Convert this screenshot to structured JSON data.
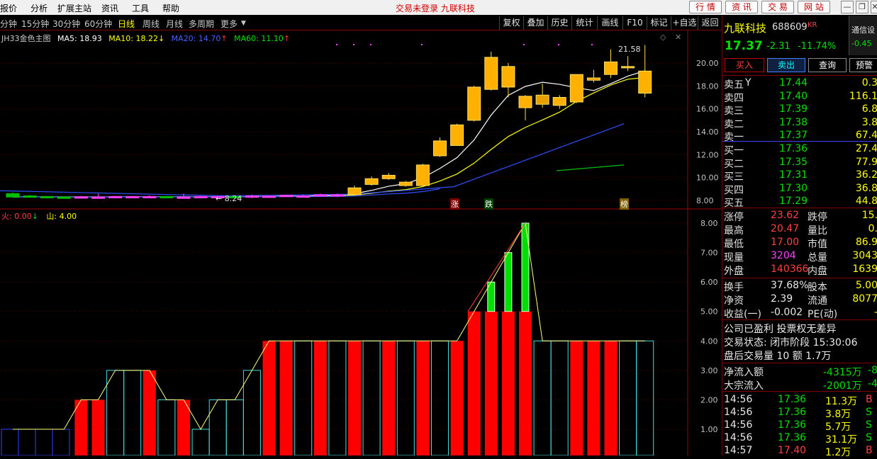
{
  "menubar": {
    "items": [
      "报价",
      "分析",
      "扩展主站",
      "资讯",
      "工具",
      "帮助"
    ],
    "status": "交易未登录 九联科技",
    "buttons": [
      "行 情",
      "资 讯",
      "交 易",
      "网 站"
    ]
  },
  "periods": {
    "items": [
      "分钟",
      "15分钟",
      "30分钟",
      "60分钟",
      "日线",
      "周线",
      "月线",
      "多周期",
      "更多"
    ],
    "active": "日线",
    "tools": [
      "复权",
      "叠加",
      "历史",
      "统计",
      "画线",
      "F10",
      "标记",
      "+自选",
      "返回"
    ]
  },
  "main_chart": {
    "indicator_name": "JH33金色主图",
    "ma": [
      {
        "label": "MA5: 18.93",
        "color": "#ffffff"
      },
      {
        "label": "MA10: 18.22",
        "color": "#ffff00",
        "arrow": "↓"
      },
      {
        "label": "MA20: 14.70",
        "color": "#4040ff",
        "arrow": "↑"
      },
      {
        "label": "MA60: 11.10",
        "color": "#00e000",
        "arrow": "↑"
      }
    ],
    "high_label": "21.58",
    "low_label": "8.24",
    "y_ticks": [
      "20.00",
      "18.00",
      "16.00",
      "14.00",
      "12.00",
      "10.00",
      "8.00"
    ],
    "markers": [
      "涨",
      "跌",
      "榜"
    ]
  },
  "sub_chart": {
    "label1": "火: 0.00",
    "label1_arrow": "↓",
    "label2": "山: 4.00",
    "y_ticks": [
      "8.00",
      "7.00",
      "6.00",
      "5.00",
      "4.00",
      "3.00",
      "2.00",
      "1.00"
    ]
  },
  "chart_data": {
    "type": "bar",
    "sub_series_levels": [
      1,
      1,
      1,
      1,
      2,
      2,
      3,
      3,
      3,
      2,
      2,
      1,
      2,
      2,
      3,
      4,
      4,
      4,
      4,
      4,
      4,
      4,
      4,
      4,
      4,
      4,
      4,
      5,
      6,
      7,
      8,
      4,
      4,
      4,
      4,
      4,
      4,
      4
    ],
    "ylim": [
      0.5,
      8.5
    ]
  },
  "stock": {
    "name": "九联科技",
    "code": "688609",
    "badge": "KR",
    "price": "17.37",
    "change": "-2.31",
    "pct": "-11.74%",
    "sector": "通信设",
    "sector_pct": "-0.45",
    "buttons": [
      "买入",
      "卖出",
      "查询",
      "预警"
    ],
    "asks": [
      {
        "label": "卖五",
        "mark": "Y",
        "price": "17.44",
        "vol": "0.3"
      },
      {
        "label": "卖四",
        "mark": "",
        "price": "17.40",
        "vol": "116.1"
      },
      {
        "label": "卖三",
        "mark": "",
        "price": "17.39",
        "vol": "6.8"
      },
      {
        "label": "卖二",
        "mark": "",
        "price": "17.38",
        "vol": "3.8"
      },
      {
        "label": "卖一",
        "mark": "",
        "price": "17.37",
        "vol": "67.4"
      }
    ],
    "bids": [
      {
        "label": "买一",
        "price": "17.36",
        "vol": "27.4"
      },
      {
        "label": "买二",
        "price": "17.35",
        "vol": "77.9"
      },
      {
        "label": "买三",
        "price": "17.31",
        "vol": "36.2"
      },
      {
        "label": "买四",
        "price": "17.30",
        "vol": "36.8"
      },
      {
        "label": "买五",
        "price": "17.29",
        "vol": "44.8"
      }
    ],
    "stats": [
      {
        "l1": "涨停",
        "v1": "23.62",
        "c1": "red",
        "l2": "跌停",
        "v2": "15."
      },
      {
        "l1": "最高",
        "v1": "20.47",
        "c1": "red",
        "l2": "量比",
        "v2": "0."
      },
      {
        "l1": "最低",
        "v1": "17.00",
        "c1": "red",
        "l2": "市值",
        "v2": "86.9"
      },
      {
        "l1": "现量",
        "v1": "3204",
        "c1": "mag",
        "l2": "总量",
        "v2": "3043"
      },
      {
        "l1": "外盘",
        "v1": "140366",
        "c1": "red",
        "l2": "内盘",
        "v2": "1639"
      }
    ],
    "stats2": [
      {
        "l1": "换手",
        "v1": "37.68%",
        "l2": "股本",
        "v2": "5.00"
      },
      {
        "l1": "净资",
        "v1": "2.39",
        "l2": "流通",
        "v2": "8077"
      },
      {
        "l1": "收益(一)",
        "v1": "-0.002",
        "l2": "PE(动)",
        "v2": "-"
      }
    ],
    "info": [
      "公司已盈利 投票权无差异",
      "交易状态: 闭市阶段 15:30:06",
      "盘后交易量 10 额 1.7万"
    ],
    "flows": [
      {
        "label": "净流入额",
        "value": "-4315万",
        "tail": "-8"
      },
      {
        "label": "大宗流入",
        "value": "-2001万",
        "tail": "-4"
      }
    ],
    "ticks": [
      {
        "time": "14:56",
        "price": "17.36",
        "vol": "11.3万",
        "bs": "B"
      },
      {
        "time": "14:56",
        "price": "17.36",
        "vol": "3.8万",
        "bs": "S"
      },
      {
        "time": "14:56",
        "price": "17.36",
        "vol": "5.7万",
        "bs": "S"
      },
      {
        "time": "14:56",
        "price": "17.36",
        "vol": "31.1万",
        "bs": "S"
      },
      {
        "time": "14:57",
        "price": "17.40",
        "vol": "1.2万",
        "bs": "B"
      }
    ]
  }
}
